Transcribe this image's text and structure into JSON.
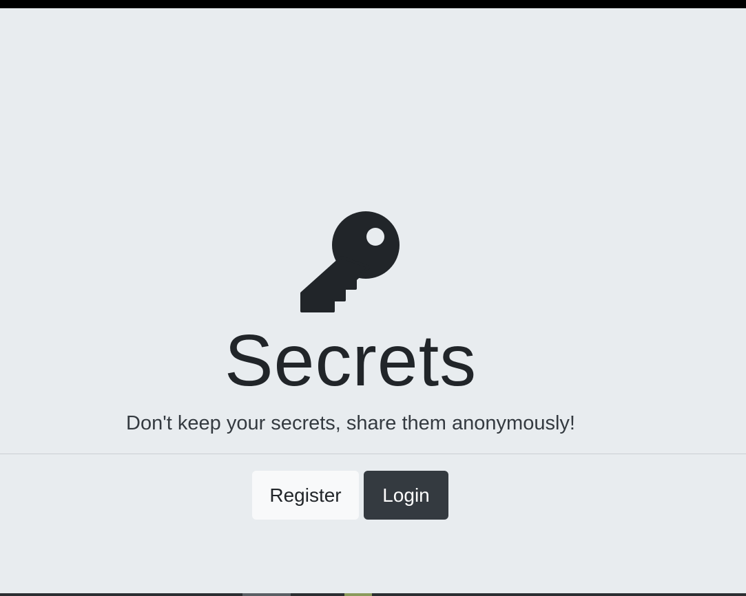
{
  "hero": {
    "icon": "key-icon",
    "title": "Secrets",
    "subtitle": "Don't keep your secrets, share them anonymously!"
  },
  "actions": {
    "register_label": "Register",
    "login_label": "Login"
  },
  "colors": {
    "background": "#e8ecef",
    "text": "#212529",
    "register_bg": "#f8f9fa",
    "login_bg": "#343a40"
  }
}
